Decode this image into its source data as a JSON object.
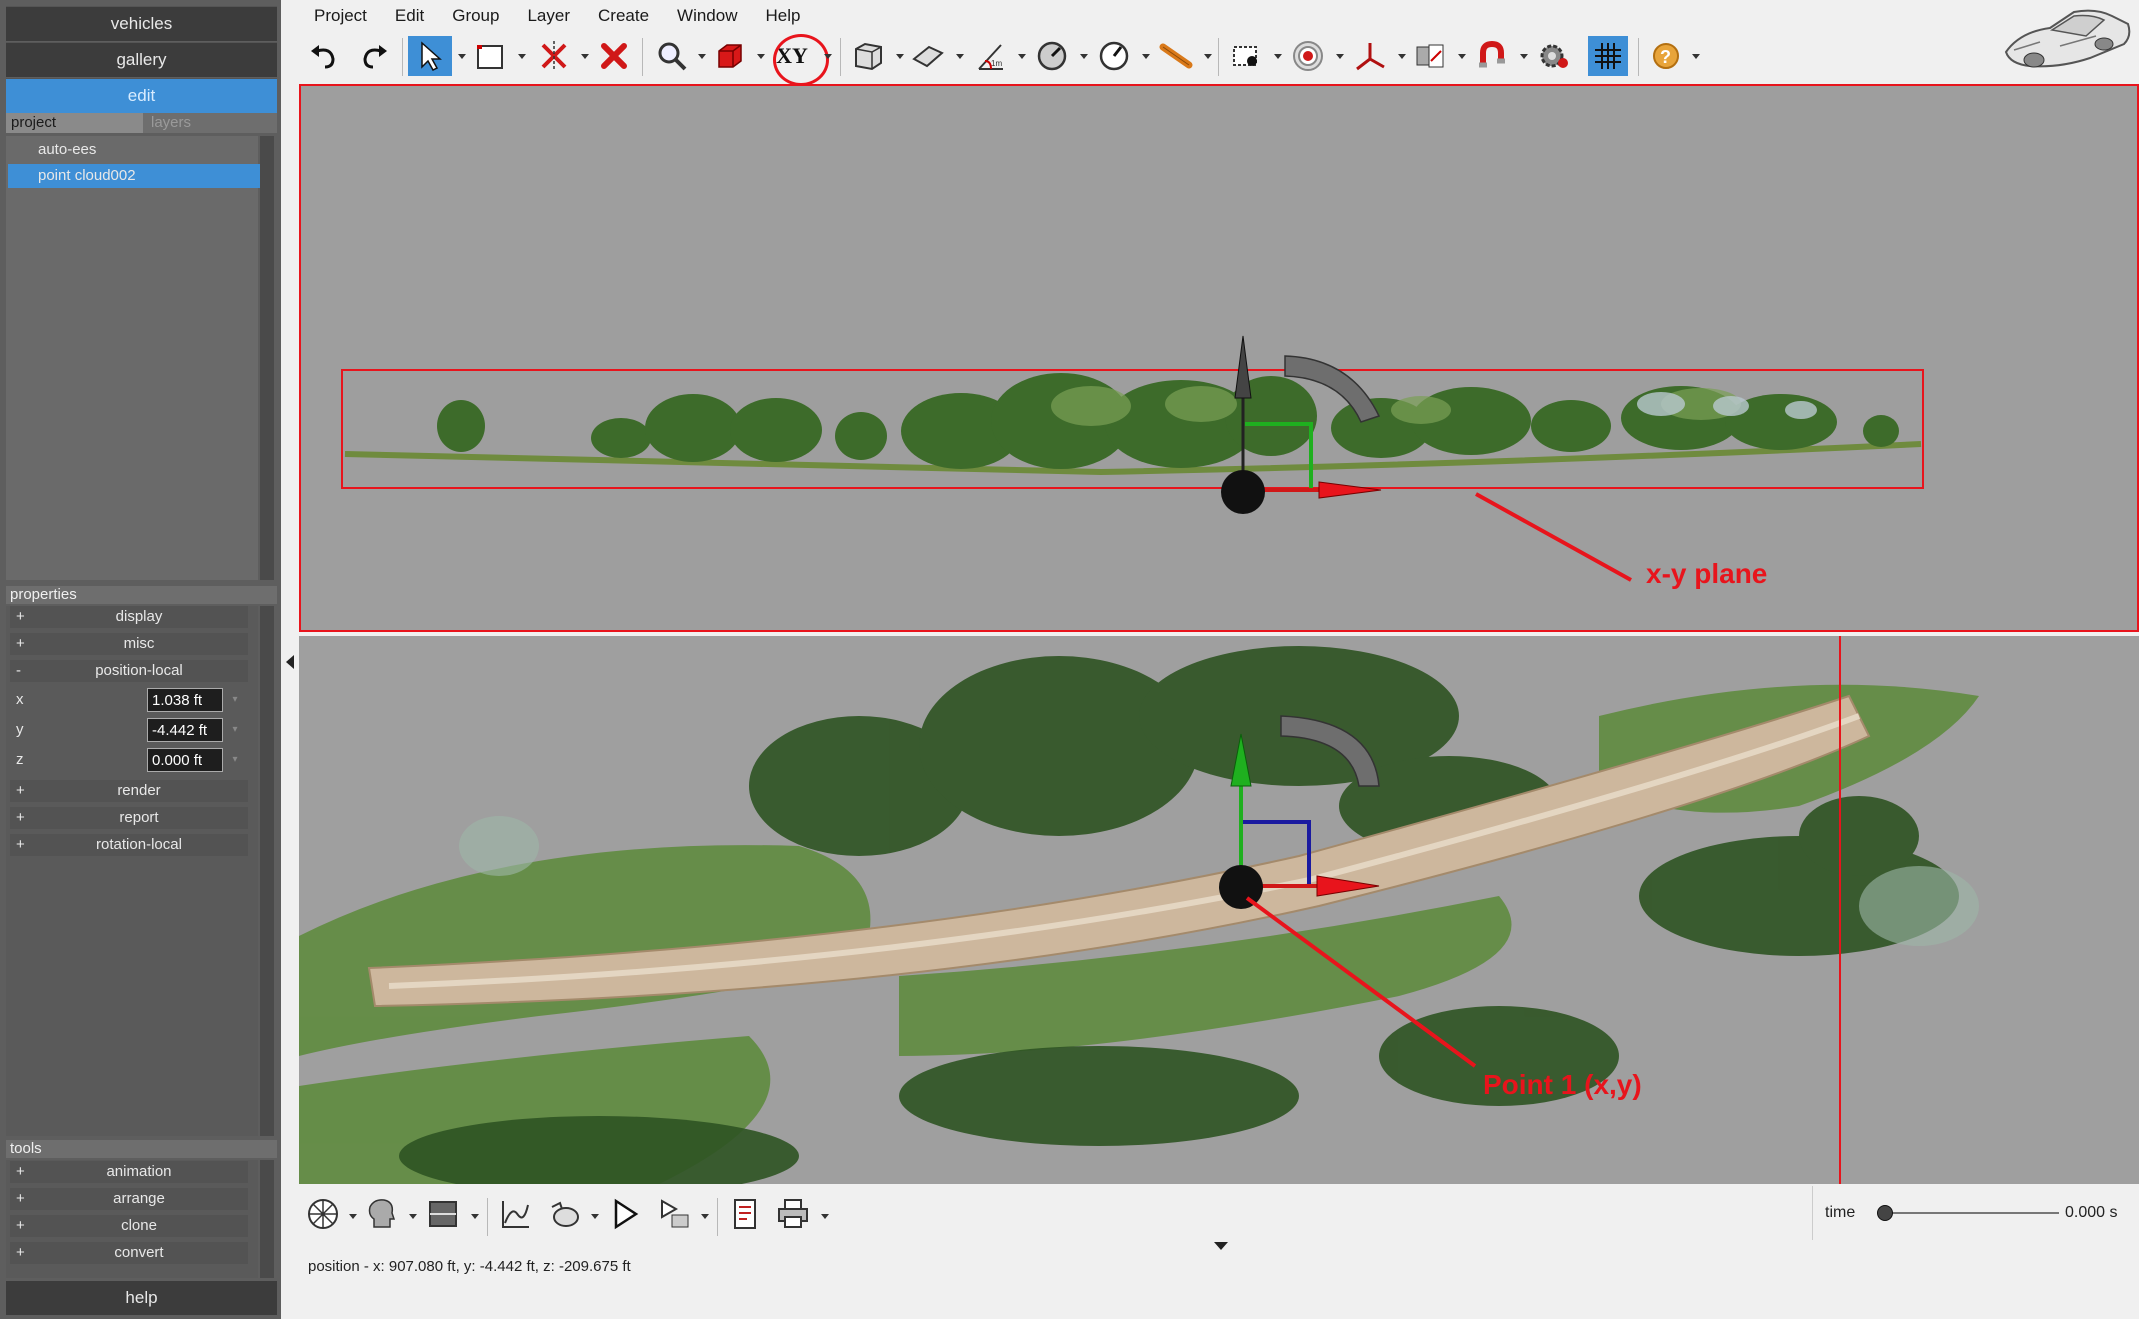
{
  "nav": {
    "vehicles": "vehicles",
    "gallery": "gallery",
    "edit": "edit",
    "help": "help"
  },
  "project_tabs": {
    "project": "project",
    "layers": "layers"
  },
  "layers": [
    {
      "label": "auto-ees",
      "selected": false
    },
    {
      "label": "point cloud002",
      "selected": true
    }
  ],
  "properties": {
    "header": "properties",
    "rows": [
      {
        "sign": "+",
        "label": "display"
      },
      {
        "sign": "+",
        "label": "misc"
      },
      {
        "sign": "-",
        "label": "position-local"
      }
    ],
    "fields": [
      {
        "name": "x",
        "value": "1.038 ft"
      },
      {
        "name": "y",
        "value": "-4.442 ft"
      },
      {
        "name": "z",
        "value": "0.000 ft"
      }
    ],
    "rows_after": [
      {
        "sign": "+",
        "label": "render"
      },
      {
        "sign": "+",
        "label": "report"
      },
      {
        "sign": "+",
        "label": "rotation-local"
      }
    ]
  },
  "tools": {
    "header": "tools",
    "rows": [
      {
        "sign": "+",
        "label": "animation"
      },
      {
        "sign": "+",
        "label": "arrange"
      },
      {
        "sign": "+",
        "label": "clone"
      },
      {
        "sign": "+",
        "label": "convert"
      }
    ]
  },
  "menu": [
    "Project",
    "Edit",
    "Group",
    "Layer",
    "Create",
    "Window",
    "Help"
  ],
  "toolbar": {
    "xy_label": "XY"
  },
  "annotations": {
    "plane": "x-y plane",
    "point": "Point 1 (x,y)"
  },
  "status": {
    "position": "position - x: 907.080 ft, y: -4.442 ft, z: -209.675 ft"
  },
  "time": {
    "label": "time",
    "value": "0.000 s",
    "slider_fraction": 0.0
  },
  "colors": {
    "accent": "#3e8fd6",
    "annotation": "#e8141c",
    "panel": "#5e5e5e",
    "viewport": "#9e9e9e"
  }
}
